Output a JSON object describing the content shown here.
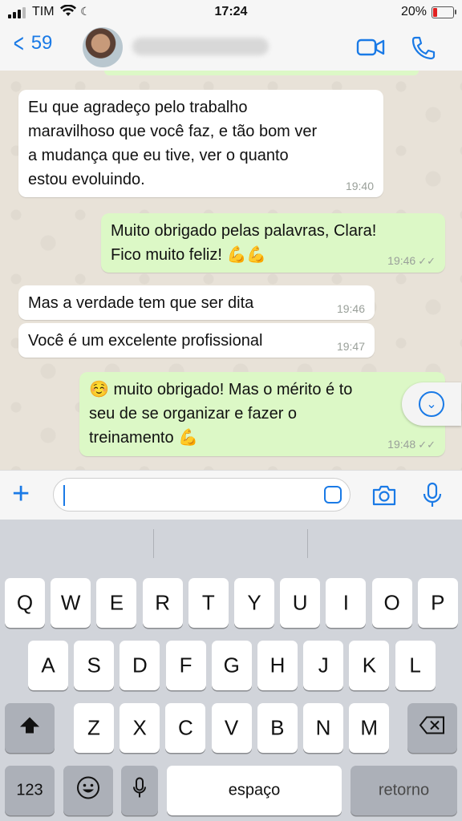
{
  "status_bar": {
    "carrier": "TIM",
    "time": "17:24",
    "battery_pct": "20%"
  },
  "header": {
    "back_count": "59"
  },
  "messages": [
    {
      "dir": "in",
      "text": "Eu que agradeço pelo trabalho maravilhoso que você faz, e tão bom ver a mudança que eu tive, ver o quanto estou evoluindo.",
      "time": "19:40"
    },
    {
      "dir": "out",
      "text": "Muito obrigado pelas palavras, Clara! Fico muito feliz! 💪💪",
      "time": "19:46"
    },
    {
      "dir": "in",
      "text": "Mas a verdade tem que ser dita",
      "time": "19:46"
    },
    {
      "dir": "in",
      "text": "Você é um excelente profissional",
      "time": "19:47"
    },
    {
      "dir": "out",
      "text": "☺️ muito obrigado! Mas o mérito é to... seu de se organizar e fazer o treinamento 💪",
      "time": "19:48"
    }
  ],
  "bubble_lines": {
    "m1": [
      "Eu que agradeço pelo trabalho",
      "maravilhoso que você faz, e tão bom ver",
      "a mudança que eu tive, ver o quanto",
      "estou evoluindo."
    ],
    "m2": [
      "Muito obrigado pelas palavras, Clara!",
      "Fico muito feliz! 💪💪"
    ],
    "m5": [
      "☺️ muito obrigado! Mas o mérito é to",
      "seu de se organizar e fazer o",
      "treinamento 💪"
    ]
  },
  "keyboard": {
    "row1": [
      "Q",
      "W",
      "E",
      "R",
      "T",
      "Y",
      "U",
      "I",
      "O",
      "P"
    ],
    "row2": [
      "A",
      "S",
      "D",
      "F",
      "G",
      "H",
      "J",
      "K",
      "L"
    ],
    "row3": [
      "Z",
      "X",
      "C",
      "V",
      "B",
      "N",
      "M"
    ],
    "numbers_key": "123",
    "space_key": "espaço",
    "return_key": "retorno"
  },
  "colors": {
    "accent": "#1a7ae6",
    "outgoing": "#dcf8c6",
    "incoming": "#ffffff"
  },
  "icons": [
    "signal-icon",
    "wifi-icon",
    "do-not-disturb-icon",
    "battery-icon",
    "back-chevron-icon",
    "video-call-icon",
    "phone-icon",
    "scroll-down-icon",
    "plus-icon",
    "sticker-icon",
    "camera-icon",
    "microphone-icon",
    "shift-icon",
    "backspace-icon",
    "emoji-icon",
    "dictation-icon"
  ]
}
